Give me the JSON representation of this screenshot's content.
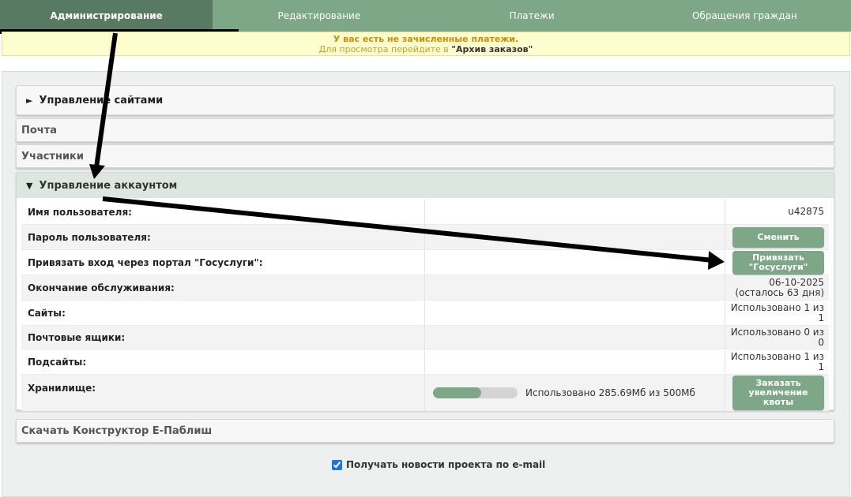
{
  "nav": {
    "tabs": [
      {
        "label": "Администрирование",
        "active": true
      },
      {
        "label": "Редактирование",
        "active": false
      },
      {
        "label": "Платежи",
        "active": false
      },
      {
        "label": "Обращения граждан",
        "active": false
      }
    ]
  },
  "notice": {
    "line1": "У вас есть не зачисленные платежи.",
    "line2_prefix": "Для просмотра перейдите в ",
    "line2_link": "\"Архив заказов\""
  },
  "sections": {
    "sites": "Управление сайтами",
    "mail": "Почта",
    "members": "Участники",
    "account": "Управление аккаунтом",
    "download": "Скачать Конструктор Е-Паблиш"
  },
  "account": {
    "username_label": "Имя пользователя:",
    "username_value": "u42875",
    "password_label": "Пароль пользователя:",
    "password_button": "Сменить",
    "gosuslugi_label": "Привязать вход через портал \"Госуслуги\":",
    "gosuslugi_button": "Привязать \"Госуслуги\"",
    "service_end_label": "Окончание обслуживания:",
    "service_end_date": "06-10-2025",
    "service_end_left": "(осталось 63 дня)",
    "sites_label": "Сайты:",
    "sites_value": "Использовано 1 из 1",
    "mailboxes_label": "Почтовые ящики:",
    "mailboxes_value": "Использовано 0 из 0",
    "subsites_label": "Подсайты:",
    "subsites_value": "Использовано 1 из 1",
    "storage_label": "Хранилище:",
    "storage_used_fraction": 0.571,
    "storage_text": "Использовано 285.69Мб из 500Мб",
    "storage_button": "Заказать увеличение квоты"
  },
  "newsletter": {
    "label": "Получать новости проекта по e-mail",
    "checked": true
  },
  "colors": {
    "brand_green": "#7da786",
    "brand_green_dark": "#597a62",
    "notice_bg": "#fefdd0",
    "notice_accent": "#d58a00"
  }
}
